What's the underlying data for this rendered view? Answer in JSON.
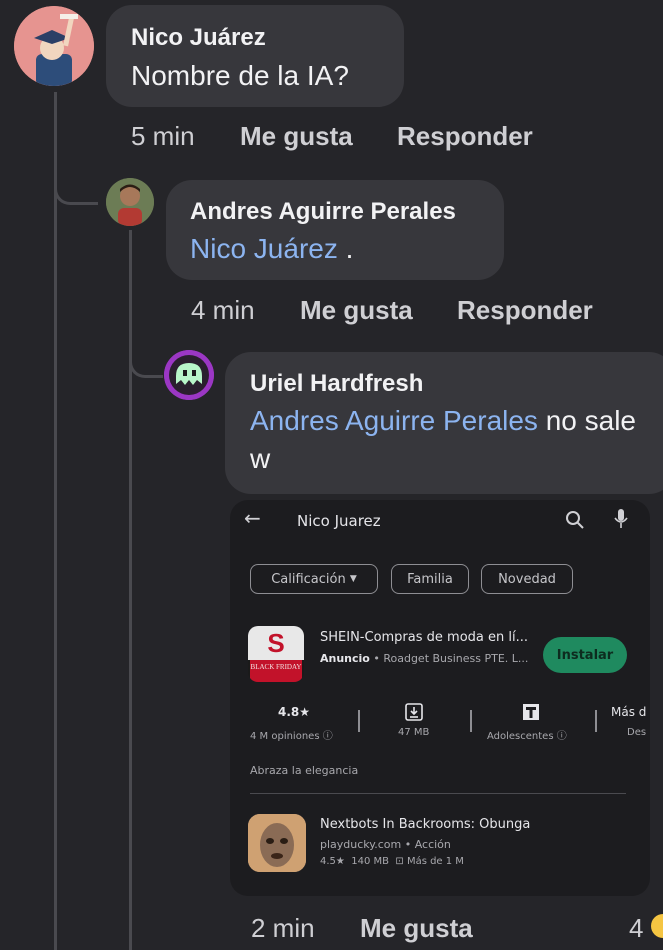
{
  "comment1": {
    "author": "Nico Juárez",
    "text": "Nombre de la IA?",
    "time": "5 min",
    "like_label": "Me gusta",
    "reply_label": "Responder"
  },
  "comment2": {
    "author": "Andres Aguirre Perales",
    "mention": "Nico Juárez",
    "text_after": " .",
    "time": "4 min",
    "like_label": "Me gusta",
    "reply_label": "Responder"
  },
  "comment3": {
    "author": "Uriel Hardfresh",
    "mention": "Andres Aguirre Perales",
    "text_after": " no sale w",
    "time": "2 min",
    "like_label": "Me gusta",
    "reaction_count": "4"
  },
  "playstore": {
    "search_query": "Nico Juarez",
    "filters": [
      "Calificación",
      "Familia",
      "Novedad"
    ],
    "app1": {
      "name": "SHEIN-Compras de moda en lí...",
      "ad_label": "Anuncio",
      "developer": "Roadget Business PTE. L...",
      "install_label": "Instalar",
      "icon_letter": "S",
      "icon_badge": "BLACK FRIDAY",
      "rating": "4.8★",
      "reviews": "4 M opiniones ⓘ",
      "size": "47 MB",
      "age": "Adolescentes ⓘ",
      "more_top": "Más d",
      "more_bottom": "Des",
      "tagline": "Abraza la elegancia"
    },
    "app2": {
      "name": "Nextbots In Backrooms: Obunga",
      "developer": "playducky.com",
      "category": "Acción",
      "rating": "4.5★",
      "size": "140 MB",
      "downloads": "Más de 1 M"
    }
  },
  "colors": {
    "background": "#252529",
    "bubble": "#37373c",
    "mention": "#8cb4f0",
    "install_button": "#1f8a5f",
    "thread_line": "#4a4a4f"
  }
}
